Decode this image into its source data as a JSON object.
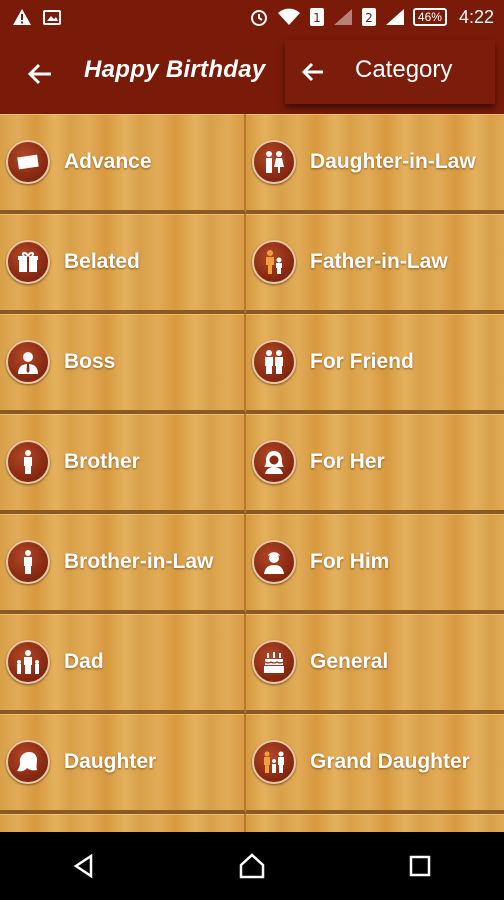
{
  "status_bar": {
    "battery": "46%",
    "time": "4:22",
    "sim1": "1",
    "sim2": "2"
  },
  "app_bar": {
    "title": "Happy Birthday"
  },
  "dialog": {
    "title": "Category"
  },
  "categories": {
    "left": [
      {
        "label": "Advance",
        "icon": "card-icon"
      },
      {
        "label": "Belated",
        "icon": "gift-icon"
      },
      {
        "label": "Boss",
        "icon": "boss-icon"
      },
      {
        "label": "Brother",
        "icon": "person-icon"
      },
      {
        "label": "Brother-in-Law",
        "icon": "person-icon"
      },
      {
        "label": "Dad",
        "icon": "dad-child-icon"
      },
      {
        "label": "Daughter",
        "icon": "girl-head-icon"
      }
    ],
    "right": [
      {
        "label": "Daughter-in-Law",
        "icon": "couple-icon"
      },
      {
        "label": "Father-in-Law",
        "icon": "man-child-icon"
      },
      {
        "label": "For Friend",
        "icon": "friends-icon"
      },
      {
        "label": "For Her",
        "icon": "woman-icon"
      },
      {
        "label": "For Him",
        "icon": "man-icon"
      },
      {
        "label": "General",
        "icon": "cake-icon"
      },
      {
        "label": "Grand Daughter",
        "icon": "family-icon"
      }
    ]
  },
  "colors": {
    "app_bar": "#7a1a08",
    "wood": "#dda34e",
    "icon_bg": "#8a2a12"
  }
}
